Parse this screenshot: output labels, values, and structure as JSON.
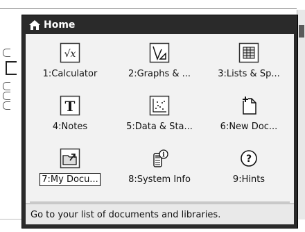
{
  "home": {
    "title": "Home",
    "items": [
      {
        "label": "1:Calculator",
        "icon": "calculator-icon"
      },
      {
        "label": "2:Graphs & ...",
        "icon": "graphs-icon"
      },
      {
        "label": "3:Lists & Sp...",
        "icon": "spreadsheet-icon"
      },
      {
        "label": "4:Notes",
        "icon": "notes-icon"
      },
      {
        "label": "5:Data & Sta...",
        "icon": "data-stats-icon"
      },
      {
        "label": "6:New Doc...",
        "icon": "new-document-icon"
      },
      {
        "label": "7:My Docu...",
        "icon": "my-documents-icon",
        "selected": true
      },
      {
        "label": "8:System Info",
        "icon": "system-info-icon"
      },
      {
        "label": "9:Hints",
        "icon": "hints-icon"
      }
    ],
    "description": "Go to your list of documents and libraries."
  }
}
